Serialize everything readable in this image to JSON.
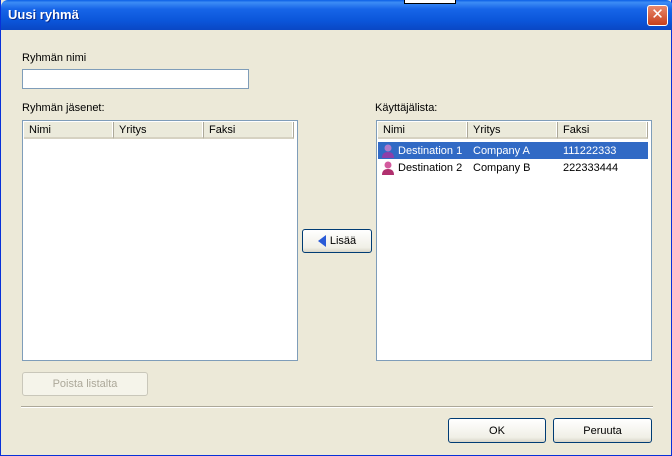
{
  "window": {
    "title": "Uusi ryhmä",
    "close_label": "✕"
  },
  "group_name": {
    "label": "Ryhmän nimi",
    "value": ""
  },
  "members": {
    "label": "Ryhmän jäsenet:",
    "columns": [
      "Nimi",
      "Yritys",
      "Faksi"
    ],
    "rows": []
  },
  "userlist": {
    "label": "Käyttäjälista:",
    "columns": [
      "Nimi",
      "Yritys",
      "Faksi"
    ],
    "rows": [
      {
        "name": "Destination 1",
        "company": "Company A",
        "fax": "111222333",
        "selected": true
      },
      {
        "name": "Destination 2",
        "company": "Company B",
        "fax": "222333444",
        "selected": false
      }
    ]
  },
  "buttons": {
    "add": "Lisää",
    "remove": "Poista listalta",
    "ok": "OK",
    "cancel": "Peruuta"
  },
  "colors": {
    "selection": "#316ac5",
    "titlebar": "#0b55d9"
  }
}
